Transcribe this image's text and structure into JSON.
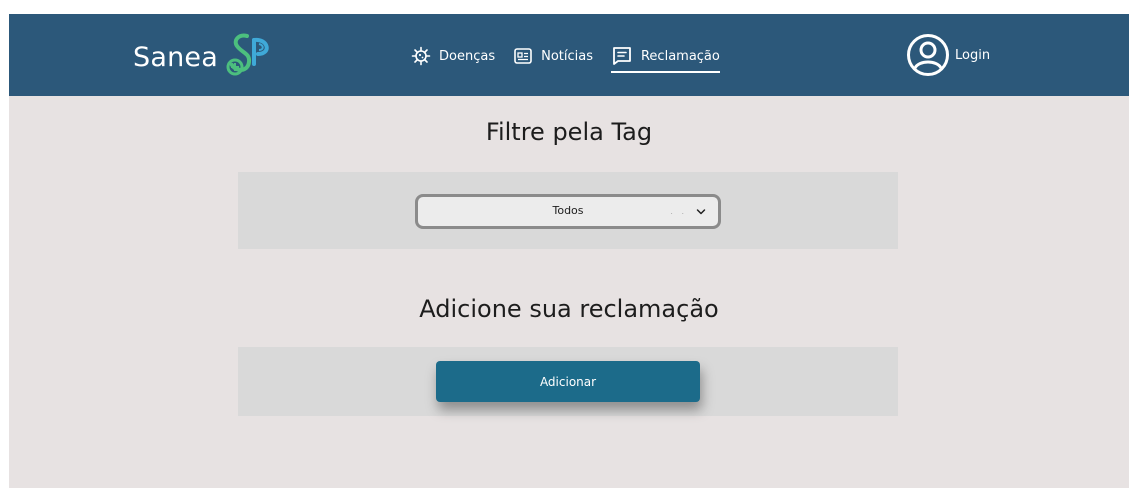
{
  "header": {
    "logo": {
      "text": "Sanea",
      "mark": "SP"
    },
    "nav": [
      {
        "label": "Doenças",
        "icon": "virus-icon",
        "active": false
      },
      {
        "label": "Notícias",
        "icon": "newspaper-icon",
        "active": false
      },
      {
        "label": "Reclamação",
        "icon": "message-square-icon",
        "active": true
      }
    ],
    "login": {
      "label": "Login",
      "icon": "user-circle-icon"
    }
  },
  "filter": {
    "title": "Filtre pela Tag",
    "select_value": "Todos",
    "select_hint": ". ."
  },
  "add": {
    "title": "Adicione sua reclamação",
    "button_label": "Adicionar"
  },
  "colors": {
    "navbar": "#2c587a",
    "background": "#e7e2e2",
    "panel": "#d9d9d9",
    "button": "#1c6b8a",
    "logo_green": "#4cbf7e",
    "logo_blue": "#3fa9d8"
  }
}
